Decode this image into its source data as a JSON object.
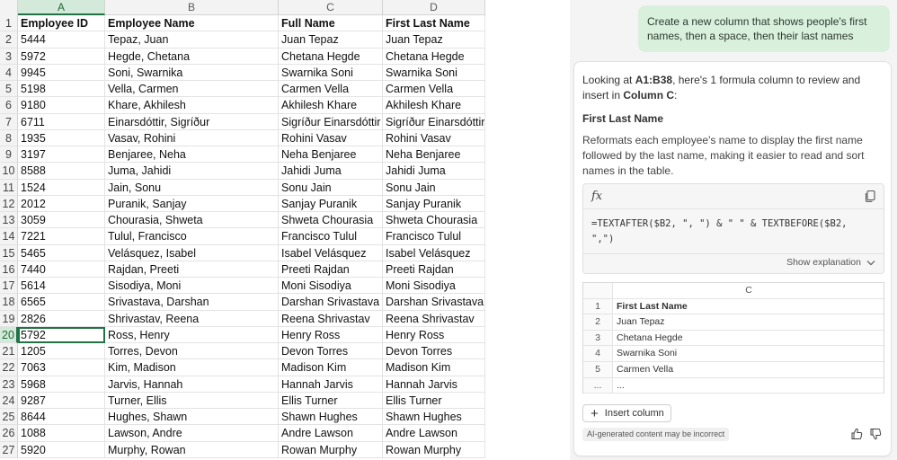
{
  "sheet": {
    "columns": [
      "A",
      "B",
      "C",
      "D"
    ],
    "headers": [
      "Employee ID",
      "Employee Name",
      "Full Name",
      "First Last Name"
    ],
    "selected_row": "20",
    "rows": [
      {
        "num": "2",
        "id": "5444",
        "name": "Tepaz, Juan",
        "full": "Juan Tepaz",
        "fl": "Juan Tepaz"
      },
      {
        "num": "3",
        "id": "5972",
        "name": "Hegde, Chetana",
        "full": "Chetana Hegde",
        "fl": "Chetana Hegde"
      },
      {
        "num": "4",
        "id": "9945",
        "name": "Soni, Swarnika",
        "full": "Swarnika Soni",
        "fl": "Swarnika Soni"
      },
      {
        "num": "5",
        "id": "5198",
        "name": "Vella, Carmen",
        "full": "Carmen Vella",
        "fl": "Carmen Vella"
      },
      {
        "num": "6",
        "id": "9180",
        "name": "Khare, Akhilesh",
        "full": "Akhilesh Khare",
        "fl": "Akhilesh Khare"
      },
      {
        "num": "7",
        "id": "6711",
        "name": "Einarsdóttir, Sigríður",
        "full": "Sigríður Einarsdóttir",
        "fl": "Sigríður Einarsdóttir"
      },
      {
        "num": "8",
        "id": "1935",
        "name": "Vasav, Rohini",
        "full": "Rohini Vasav",
        "fl": "Rohini Vasav"
      },
      {
        "num": "9",
        "id": "3197",
        "name": "Benjaree, Neha",
        "full": "Neha Benjaree",
        "fl": "Neha Benjaree"
      },
      {
        "num": "10",
        "id": "8588",
        "name": "Juma, Jahidi",
        "full": "Jahidi Juma",
        "fl": "Jahidi Juma"
      },
      {
        "num": "11",
        "id": "1524",
        "name": "Jain, Sonu",
        "full": "Sonu Jain",
        "fl": "Sonu Jain"
      },
      {
        "num": "12",
        "id": "2012",
        "name": "Puranik, Sanjay",
        "full": "Sanjay Puranik",
        "fl": "Sanjay Puranik"
      },
      {
        "num": "13",
        "id": "3059",
        "name": "Chourasia, Shweta",
        "full": "Shweta Chourasia",
        "fl": "Shweta Chourasia"
      },
      {
        "num": "14",
        "id": "7221",
        "name": "Tulul, Francisco",
        "full": "Francisco Tulul",
        "fl": "Francisco Tulul"
      },
      {
        "num": "15",
        "id": "5465",
        "name": "Velásquez, Isabel",
        "full": "Isabel Velásquez",
        "fl": "Isabel Velásquez"
      },
      {
        "num": "16",
        "id": "7440",
        "name": "Rajdan, Preeti",
        "full": "Preeti Rajdan",
        "fl": "Preeti Rajdan"
      },
      {
        "num": "17",
        "id": "5614",
        "name": "Sisodiya, Moni",
        "full": "Moni Sisodiya",
        "fl": "Moni Sisodiya"
      },
      {
        "num": "18",
        "id": "6565",
        "name": "Srivastava, Darshan",
        "full": "Darshan Srivastava",
        "fl": "Darshan Srivastava"
      },
      {
        "num": "19",
        "id": "2826",
        "name": "Shrivastav, Reena",
        "full": "Reena Shrivastav",
        "fl": "Reena Shrivastav"
      },
      {
        "num": "20",
        "id": "5792",
        "name": "Ross, Henry",
        "full": "Henry Ross",
        "fl": "Henry Ross"
      },
      {
        "num": "21",
        "id": "1205",
        "name": "Torres, Devon",
        "full": "Devon Torres",
        "fl": "Devon Torres"
      },
      {
        "num": "22",
        "id": "7063",
        "name": "Kim, Madison",
        "full": "Madison Kim",
        "fl": "Madison Kim"
      },
      {
        "num": "23",
        "id": "5968",
        "name": "Jarvis, Hannah",
        "full": "Hannah Jarvis",
        "fl": "Hannah Jarvis"
      },
      {
        "num": "24",
        "id": "9287",
        "name": "Turner, Ellis",
        "full": "Ellis Turner",
        "fl": "Ellis Turner"
      },
      {
        "num": "25",
        "id": "8644",
        "name": "Hughes, Shawn",
        "full": "Shawn Hughes",
        "fl": "Shawn Hughes"
      },
      {
        "num": "26",
        "id": "1088",
        "name": "Lawson, Andre",
        "full": "Andre Lawson",
        "fl": "Andre Lawson"
      },
      {
        "num": "27",
        "id": "5920",
        "name": "Murphy, Rowan",
        "full": "Rowan Murphy",
        "fl": "Rowan Murphy"
      }
    ]
  },
  "copilot": {
    "user_prompt": "Create a new column that shows people's first names, then a space, then their last names",
    "intro_pre": "Looking at ",
    "intro_range": "A1:B38",
    "intro_mid": ", here's 1 formula column to review and insert in ",
    "intro_column": "Column C",
    "intro_end": ":",
    "section_title": "First Last Name",
    "section_desc": "Reformats each employee's name to display the first name followed by the last name, making it easier to read and sort names in the table.",
    "fx_label": "fx",
    "formula": "=TEXTAFTER($B2, \", \") & \" \" & TEXTBEFORE($B2,\n\",\")",
    "show_explanation": "Show explanation",
    "preview": {
      "column_letter": "C",
      "rows": [
        {
          "num": "1",
          "value": "First Last Name"
        },
        {
          "num": "2",
          "value": "Juan Tepaz"
        },
        {
          "num": "3",
          "value": "Chetana Hegde"
        },
        {
          "num": "4",
          "value": "Swarnika Soni"
        },
        {
          "num": "5",
          "value": "Carmen Vella"
        },
        {
          "num": "...",
          "value": "..."
        }
      ]
    },
    "insert_label": "Insert column",
    "ai_notice": "AI-generated content may be incorrect"
  },
  "colors": {
    "accent": "#217346",
    "bubble": "#d9f0dc"
  }
}
